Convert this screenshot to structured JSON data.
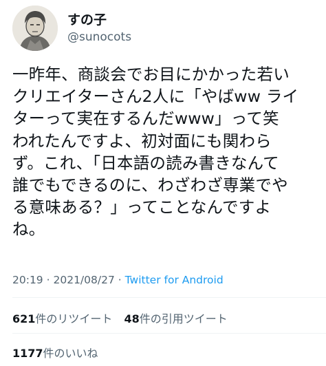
{
  "author": {
    "display_name": "すの子",
    "handle": "@sunocots",
    "avatar_icon": "avatar-illustration-icon"
  },
  "tweet": {
    "text_lines": [
      "一昨年、商談会でお目にかかった若い",
      "クリエイターさん2人に「やばww ライ",
      "ターって実在するんだwww」って笑",
      "われたんですよ、初対面にも関わら",
      "ず。これ、「日本語の読み書きなんて",
      "誰でもできるのに、わざわざ専業でや",
      "る意味ある？」ってことなんですよ",
      "ね。"
    ],
    "time": "20:19",
    "separator": "·",
    "date": "2021/08/27",
    "source": "Twitter for Android"
  },
  "stats": {
    "retweets_count": "621",
    "retweets_label": "件のリツイート",
    "quotes_count": "48",
    "quotes_label": "件の引用ツイート",
    "likes_count": "1177",
    "likes_label": "件のいいね"
  },
  "colors": {
    "text": "#0f1419",
    "secondary": "#536471",
    "link": "#1d9bf0",
    "divider": "#eff3f4"
  }
}
